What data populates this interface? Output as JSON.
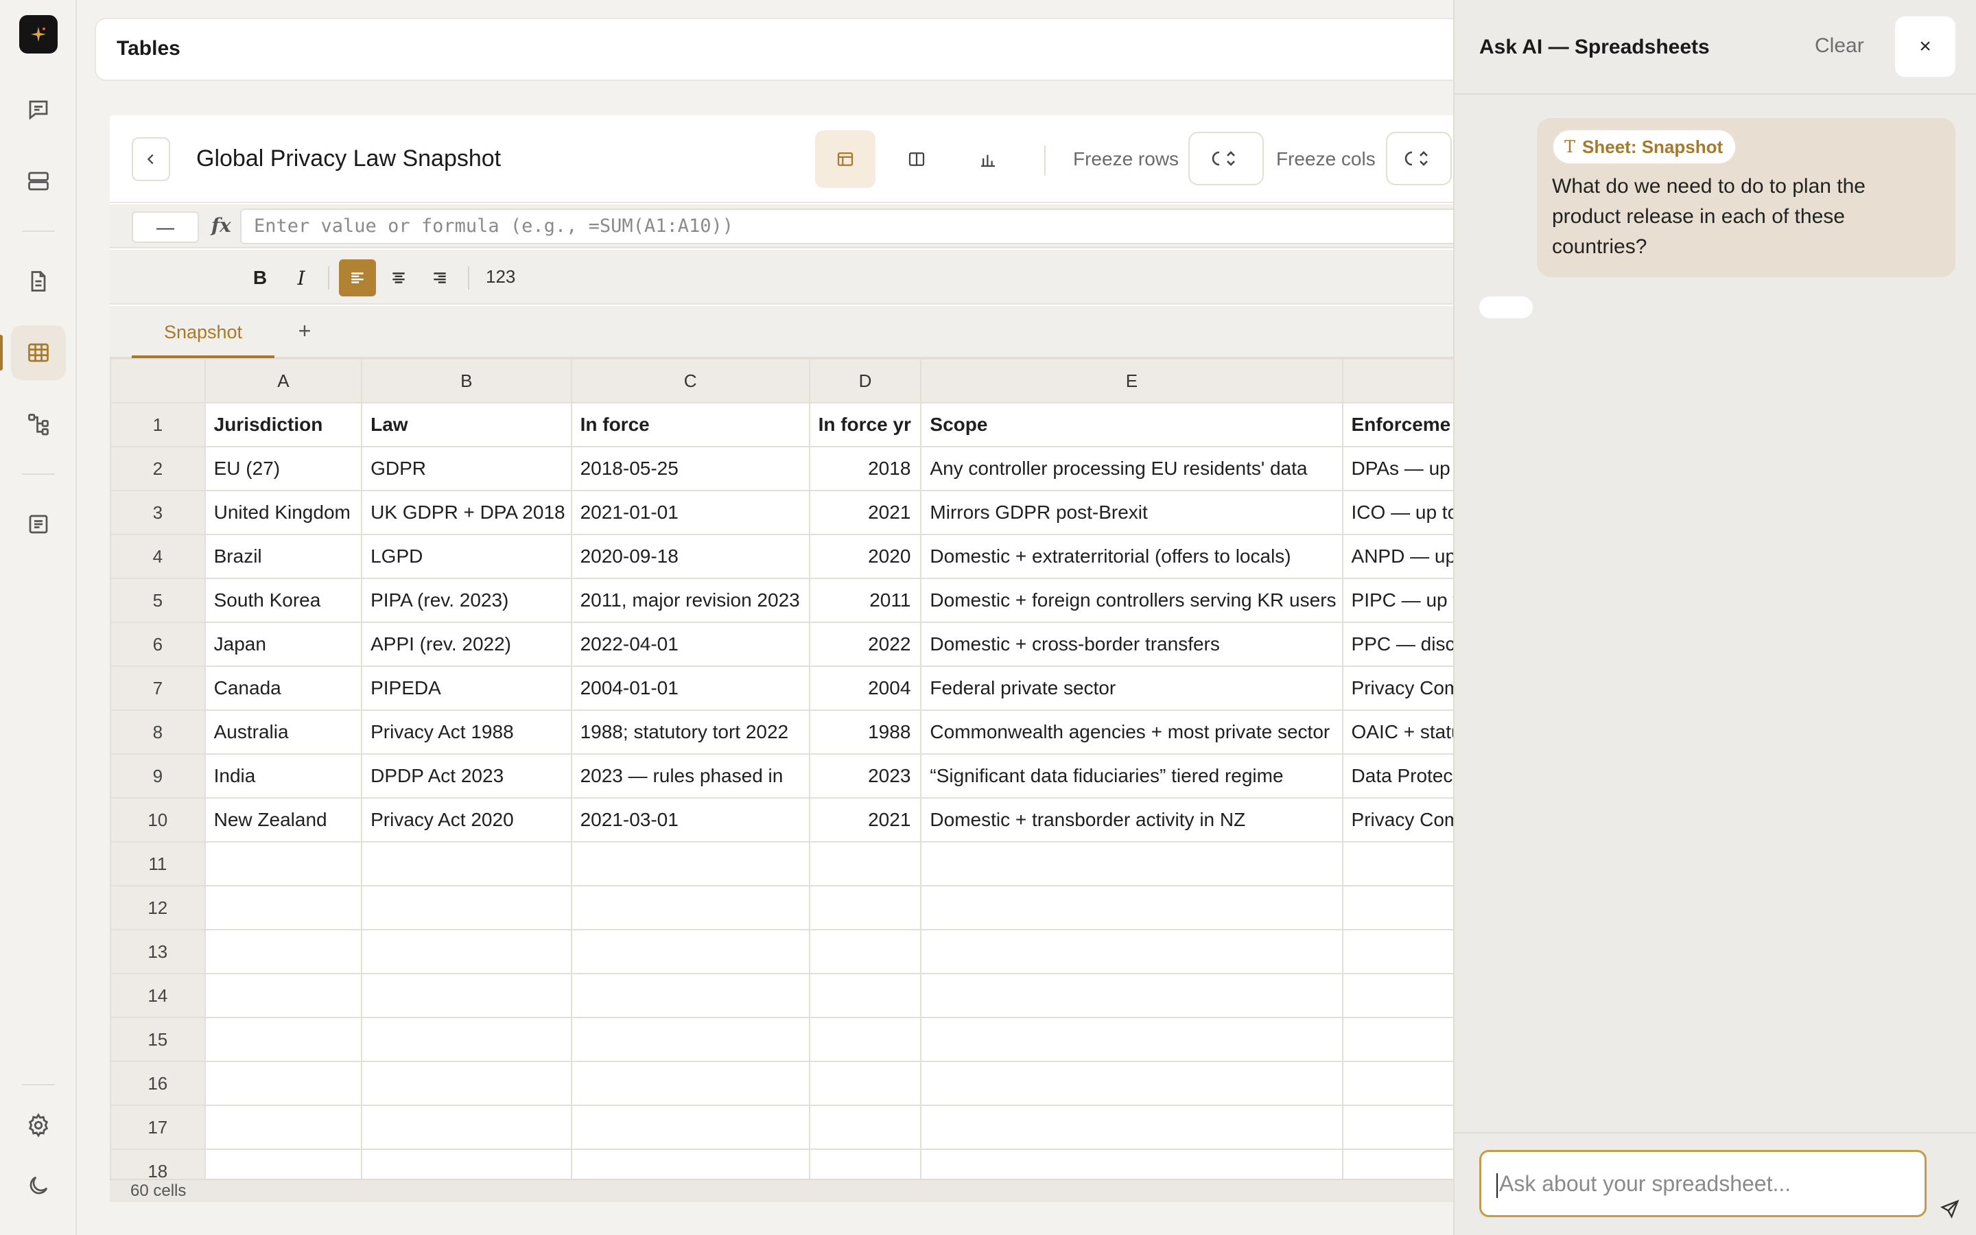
{
  "app": {
    "title": "Tables"
  },
  "rail": {
    "icons": [
      "logo-icon",
      "chat-icon",
      "database-icon",
      "document-icon",
      "table-icon",
      "workflow-icon",
      "notes-icon",
      "gear-icon",
      "moon-icon"
    ],
    "active": "table-icon"
  },
  "sheet": {
    "title": "Global Privacy Law Snapshot",
    "freeze_rows_label": "Freeze rows",
    "freeze_cols_label": "Freeze cols",
    "cell_ref": "—",
    "fx_label": "fx",
    "formula_placeholder": "Enter value or formula (e.g., =SUM(A1:A10))",
    "format": {
      "bold": "B",
      "italic": "I",
      "number": "123"
    },
    "tabs": [
      {
        "label": "Snapshot"
      }
    ],
    "add_tab": "+",
    "columns": [
      "A",
      "B",
      "C",
      "D",
      "E",
      ""
    ],
    "rows": [
      [
        "Jurisdiction",
        "Law",
        "In force",
        "In force yr",
        "Scope",
        "Enforceme"
      ],
      [
        "EU (27)",
        "GDPR",
        "2018-05-25",
        "2018",
        "Any controller processing EU residents' data",
        "DPAs — up t"
      ],
      [
        "United Kingdom",
        "UK GDPR + DPA 2018",
        "2021-01-01",
        "2021",
        "Mirrors GDPR post-Brexit",
        "ICO — up to"
      ],
      [
        "Brazil",
        "LGPD",
        "2020-09-18",
        "2020",
        "Domestic + extraterritorial (offers to locals)",
        "ANPD — up"
      ],
      [
        "South Korea",
        "PIPA (rev. 2023)",
        "2011, major revision 2023",
        "2011",
        "Domestic + foreign controllers serving KR users",
        "PIPC — up t"
      ],
      [
        "Japan",
        "APPI (rev. 2022)",
        "2022-04-01",
        "2022",
        "Domestic + cross-border transfers",
        "PPC — discl"
      ],
      [
        "Canada",
        "PIPEDA",
        "2004-01-01",
        "2004",
        "Federal private sector",
        "Privacy Com"
      ],
      [
        "Australia",
        "Privacy Act 1988",
        "1988; statutory tort 2022",
        "1988",
        "Commonwealth agencies + most private sector",
        "OAIC + statu"
      ],
      [
        "India",
        "DPDP Act 2023",
        "2023 — rules phased in",
        "2023",
        "“Significant data fiduciaries” tiered regime",
        "Data Protec"
      ],
      [
        "New Zealand",
        "Privacy Act 2020",
        "2021-03-01",
        "2021",
        "Domestic + transborder activity in NZ",
        "Privacy Com"
      ]
    ],
    "row_numbers": [
      "1",
      "2",
      "3",
      "4",
      "5",
      "6",
      "7",
      "8",
      "9",
      "10",
      "11",
      "12",
      "13",
      "14",
      "15",
      "16",
      "17",
      "18"
    ],
    "status": "60 cells"
  },
  "ai": {
    "title": "Ask AI — Spreadsheets",
    "clear_label": "Clear",
    "close_label": "×",
    "chip_icon": "T",
    "chip_label": "Sheet: Snapshot",
    "message": "What do we need to do to plan the product release in each of these countries?",
    "composer_placeholder": "Ask about your spreadsheet..."
  }
}
